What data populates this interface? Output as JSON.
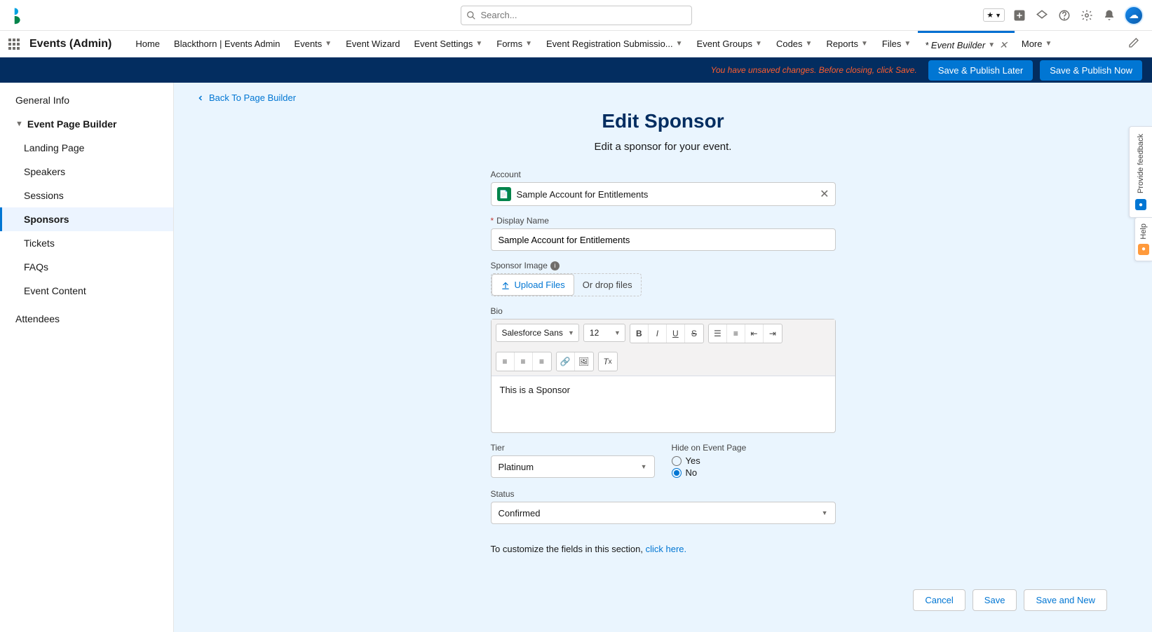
{
  "header": {
    "search_placeholder": "Search...",
    "app_title": "Events (Admin)"
  },
  "nav": {
    "items": [
      "Home",
      "Blackthorn | Events Admin",
      "Events",
      "Event Wizard",
      "Event Settings",
      "Forms",
      "Event Registration Submissio...",
      "Event Groups",
      "Codes",
      "Reports",
      "Files"
    ],
    "active_tab": "* Event Builder",
    "more": "More"
  },
  "savebar": {
    "unsaved": "You have unsaved changes. Before closing, click Save.",
    "later": "Save & Publish Later",
    "now": "Save & Publish Now"
  },
  "sidebar": {
    "general": "General Info",
    "builder": "Event Page Builder",
    "items": [
      "Landing Page",
      "Speakers",
      "Sessions",
      "Sponsors",
      "Tickets",
      "FAQs",
      "Event Content"
    ],
    "attendees": "Attendees"
  },
  "back": "Back To Page Builder",
  "page": {
    "title": "Edit Sponsor",
    "sub": "Edit a sponsor for your event."
  },
  "form": {
    "account_label": "Account",
    "account_value": "Sample Account for Entitlements",
    "display_label": "Display Name",
    "display_value": "Sample Account for Entitlements",
    "sponsor_image_label": "Sponsor Image",
    "upload_label": "Upload Files",
    "drop_label": "Or drop files",
    "bio_label": "Bio",
    "bio_value": "This is a Sponsor",
    "font_family": "Salesforce Sans",
    "font_size": "12",
    "tier_label": "Tier",
    "tier_value": "Platinum",
    "hide_label": "Hide on Event Page",
    "hide_yes": "Yes",
    "hide_no": "No",
    "status_label": "Status",
    "status_value": "Confirmed",
    "customize_text": "To customize the fields in this section, ",
    "customize_link": "click here."
  },
  "footer": {
    "cancel": "Cancel",
    "save": "Save",
    "save_new": "Save and New"
  },
  "feedback": {
    "provide": "Provide feedback",
    "help": "Help"
  }
}
